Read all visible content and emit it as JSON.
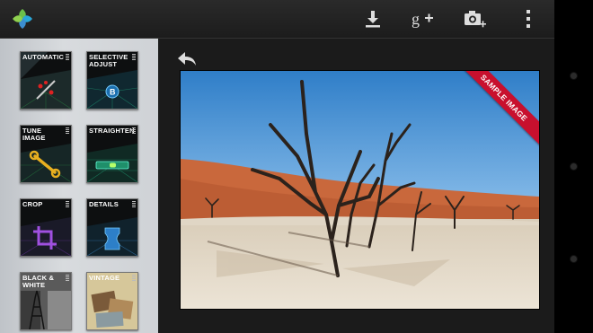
{
  "app": {
    "logo_icon": "snapseed-leaf-icon"
  },
  "actionbar": {
    "icons": [
      "download-icon",
      "google-plus-icon",
      "camera-add-icon",
      "overflow-menu-icon"
    ]
  },
  "tools": [
    {
      "label": "AUTOMATIC",
      "icon": "magic-wand-icon"
    },
    {
      "label": "SELECTIVE ADJUST",
      "icon": "control-point-icon"
    },
    {
      "label": "TUNE IMAGE",
      "icon": "wrench-icon"
    },
    {
      "label": "STRAIGHTEN",
      "icon": "level-icon"
    },
    {
      "label": "CROP",
      "icon": "crop-icon"
    },
    {
      "label": "DETAILS",
      "icon": "details-icon"
    },
    {
      "label": "BLACK & WHITE",
      "icon": "eiffel-tower-icon"
    },
    {
      "label": "VINTAGE",
      "icon": "vintage-icon"
    }
  ],
  "main": {
    "back_icon": "undo-icon",
    "ribbon_label": "SAMPLE IMAGE"
  },
  "colors": {
    "ribbon": "#c8102e",
    "sky": "#2f7ec8",
    "dune": "#c9683c",
    "sand": "#e6ddcf"
  }
}
